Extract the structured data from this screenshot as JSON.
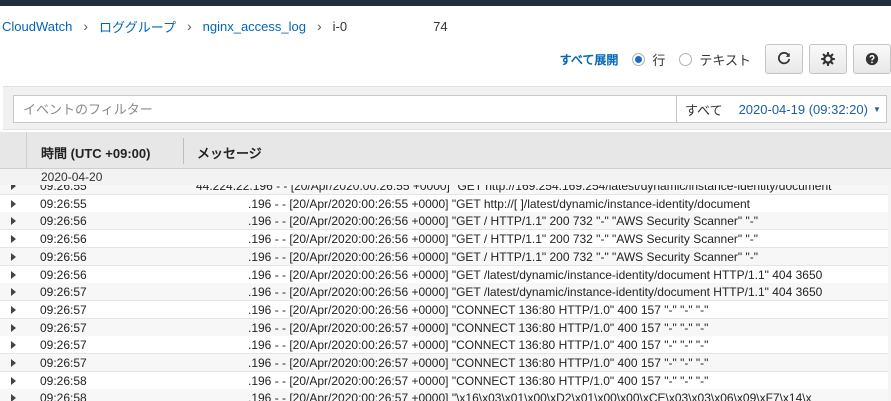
{
  "breadcrumb": {
    "items": [
      "CloudWatch",
      "ロググループ",
      "nginx_access_log"
    ],
    "current": "i-0",
    "current_suffix": "74"
  },
  "view": {
    "expand_all": "すべて展開",
    "options": [
      {
        "label": "行",
        "selected": true
      },
      {
        "label": "テキスト",
        "selected": false
      }
    ],
    "buttons": [
      {
        "name": "refresh-icon"
      },
      {
        "name": "gear-icon"
      },
      {
        "name": "help-icon"
      }
    ]
  },
  "filter": {
    "placeholder": "イベントのフィルター",
    "value": "",
    "range_all": "すべて",
    "range_date": "2020-04-19 (09:32:20)"
  },
  "columns": {
    "time": "時間 (UTC +09:00)",
    "message": "メッセージ"
  },
  "date_group": "2020-04-20",
  "rows": [
    {
      "time": "09:26:55",
      "message": "44.224.22.196 - - [20/Apr/2020:00:26:55 +0000] \"GET http://169.254.169.254/latest/dynamic/instance-identity/document"
    },
    {
      "time": "09:26:55",
      "message": ".196 - - [20/Apr/2020:00:26:55 +0000] \"GET http://[                    ]/latest/dynamic/instance-identity/document"
    },
    {
      "time": "09:26:56",
      "message": ".196 - - [20/Apr/2020:00:26:56 +0000] \"GET / HTTP/1.1\" 200 732 \"-\" \"AWS Security Scanner\" \"-\""
    },
    {
      "time": "09:26:56",
      "message": ".196 - - [20/Apr/2020:00:26:56 +0000] \"GET / HTTP/1.1\" 200 732 \"-\" \"AWS Security Scanner\" \"-\""
    },
    {
      "time": "09:26:56",
      "message": ".196 - - [20/Apr/2020:00:26:56 +0000] \"GET / HTTP/1.1\" 200 732 \"-\" \"AWS Security Scanner\" \"-\""
    },
    {
      "time": "09:26:56",
      "message": ".196 - - [20/Apr/2020:00:26:56 +0000] \"GET /latest/dynamic/instance-identity/document HTTP/1.1\" 404 3650"
    },
    {
      "time": "09:26:57",
      "message": ".196 - - [20/Apr/2020:00:26:56 +0000] \"GET /latest/dynamic/instance-identity/document HTTP/1.1\" 404 3650"
    },
    {
      "time": "09:26:57",
      "message": ".196 - - [20/Apr/2020:00:26:56 +0000] \"CONNECT                    136:80 HTTP/1.0\" 400 157 \"-\" \"-\" \"-\""
    },
    {
      "time": "09:26:57",
      "message": ".196 - - [20/Apr/2020:00:26:57 +0000] \"CONNECT                    136:80 HTTP/1.0\" 400 157 \"-\" \"-\" \"-\""
    },
    {
      "time": "09:26:57",
      "message": ".196 - - [20/Apr/2020:00:26:57 +0000] \"CONNECT                    136:80 HTTP/1.0\" 400 157 \"-\" \"-\" \"-\""
    },
    {
      "time": "09:26:57",
      "message": ".196 - - [20/Apr/2020:00:26:57 +0000] \"CONNECT                    136:80 HTTP/1.0\" 400 157 \"-\" \"-\" \"-\""
    },
    {
      "time": "09:26:58",
      "message": ".196 - - [20/Apr/2020:00:26:57 +0000] \"CONNECT                    136:80 HTTP/1.0\" 400 157 \"-\" \"-\" \"-\""
    },
    {
      "time": "09:26:58",
      "message": ".196 - - [20/Apr/2020:00:26:57 +0000] \"\\x16\\x03\\x01\\x00\\xD2\\x01\\x00\\x00\\xCE\\x03\\x03\\x06\\x09\\xF7\\x14\\x"
    }
  ]
}
